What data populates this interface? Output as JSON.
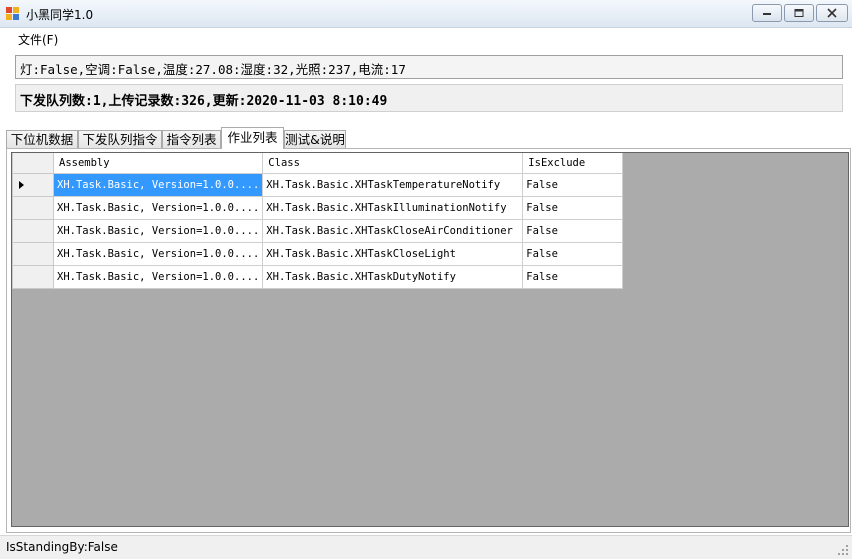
{
  "window": {
    "title": "小黑同学1.0",
    "icon": "app-icon",
    "controls": [
      "minimize-icon",
      "maximize-icon",
      "close-icon"
    ]
  },
  "menu": {
    "file_label": "文件(F)"
  },
  "status_line": "灯:False,空调:False,温度:27.08:湿度:32,光照:237,电流:17",
  "queue_line": "下发队列数:1,上传记录数:326,更新:2020-11-03 8:10:49",
  "tabs": [
    {
      "label": "下位机数据",
      "active": false
    },
    {
      "label": "下发队列指令",
      "active": false
    },
    {
      "label": "指令列表",
      "active": false
    },
    {
      "label": "作业列表",
      "active": true
    },
    {
      "label": "测试&说明",
      "active": false
    }
  ],
  "grid": {
    "columns": [
      "Assembly",
      "Class",
      "IsExclude"
    ],
    "rows": [
      [
        "XH.Task.Basic, Version=1.0.0....",
        "XH.Task.Basic.XHTaskTemperatureNotify",
        "False"
      ],
      [
        "XH.Task.Basic, Version=1.0.0....",
        "XH.Task.Basic.XHTaskIlluminationNotify",
        "False"
      ],
      [
        "XH.Task.Basic, Version=1.0.0....",
        "XH.Task.Basic.XHTaskCloseAirConditioner",
        "False"
      ],
      [
        "XH.Task.Basic, Version=1.0.0....",
        "XH.Task.Basic.XHTaskCloseLight",
        "False"
      ],
      [
        "XH.Task.Basic, Version=1.0.0....",
        "XH.Task.Basic.XHTaskDutyNotify",
        "False"
      ]
    ],
    "selected_row": 0,
    "selection_color": "#3399ff",
    "background_color": "#ababab"
  },
  "statusbar": {
    "text": "IsStandingBy:False"
  }
}
